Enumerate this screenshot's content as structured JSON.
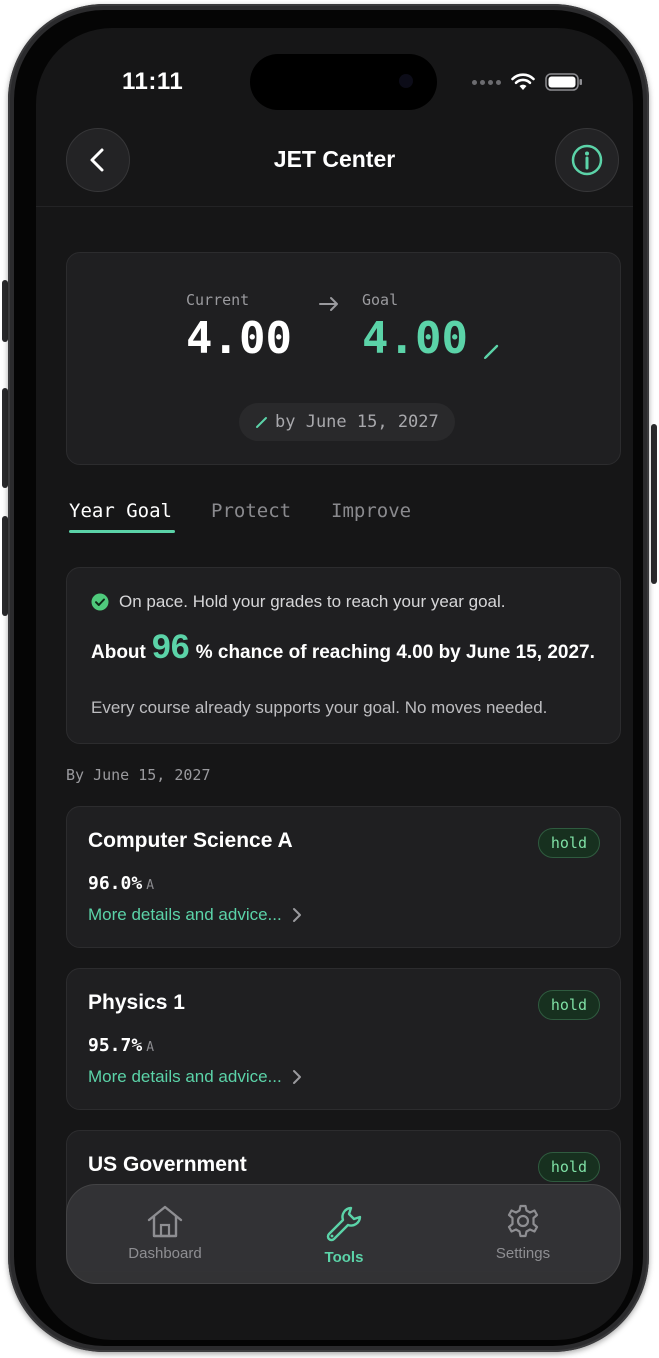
{
  "status": {
    "time": "11:11"
  },
  "header": {
    "title": "JET Center"
  },
  "gpa": {
    "current_label": "Current",
    "current_value": "4.00",
    "goal_label": "Goal",
    "goal_value": "4.00",
    "deadline": "by June 15, 2027"
  },
  "tabs": [
    {
      "label": "Year Goal",
      "active": true
    },
    {
      "label": "Protect",
      "active": false
    },
    {
      "label": "Improve",
      "active": false
    }
  ],
  "pace": {
    "status": "On pace. Hold your grades to reach your year goal.",
    "chance_prefix": "About",
    "chance_value": "96",
    "chance_suffix": "% chance of reaching 4.00 by June 15, 2027.",
    "note": "Every course already supports your goal. No moves needed."
  },
  "section_label": "By June 15, 2027",
  "courses": [
    {
      "name": "Computer Science A",
      "badge": "hold",
      "percent": "96.0%",
      "grade": "A",
      "link": "More details and advice..."
    },
    {
      "name": "Physics 1",
      "badge": "hold",
      "percent": "95.7%",
      "grade": "A",
      "link": "More details and advice..."
    },
    {
      "name": "US Government",
      "badge": "hold"
    }
  ],
  "nav": [
    {
      "label": "Dashboard",
      "icon": "home-icon",
      "active": false
    },
    {
      "label": "Tools",
      "icon": "wrench-icon",
      "active": true
    },
    {
      "label": "Settings",
      "icon": "gear-icon",
      "active": false
    }
  ],
  "colors": {
    "accent": "#5bd3a8",
    "background": "#161617",
    "card": "#1f1f21",
    "badge_text": "#7fe0a5"
  }
}
